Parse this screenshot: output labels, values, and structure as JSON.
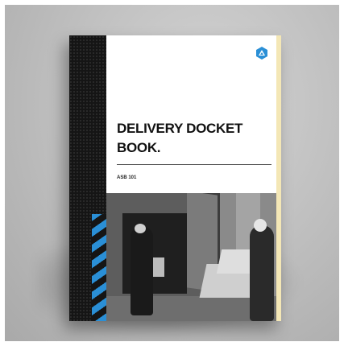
{
  "cover": {
    "title_line1": "DELIVERY DOCKET",
    "title_line2": "BOOK.",
    "code": "ASB 101"
  },
  "colors": {
    "spine": "#151515",
    "accent_stripe": "#2a8fd6",
    "page_edge": "#f4e7b6",
    "background": "#bdbdbd"
  },
  "icons": {
    "logo": "triangle-in-hexagon-logo"
  }
}
